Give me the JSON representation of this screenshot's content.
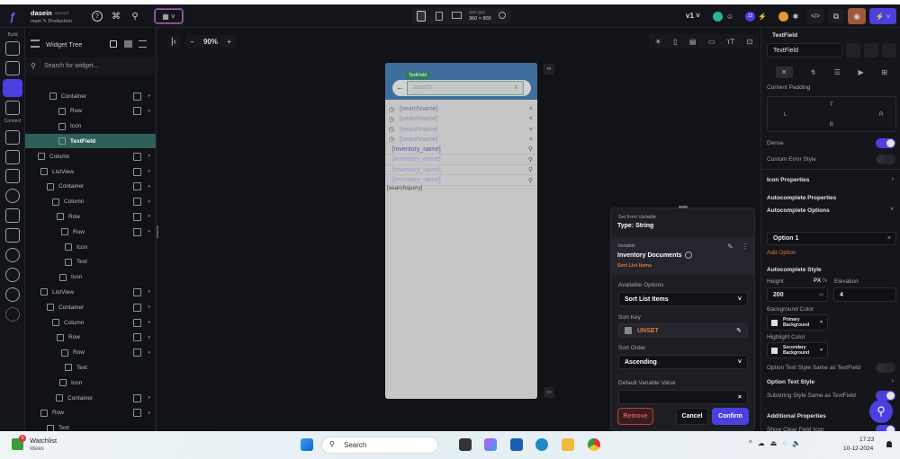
{
  "project": {
    "name": "dasein",
    "sync": "Synced",
    "branch": "main",
    "env": "Production"
  },
  "toolbar": {
    "size_label": "Size (px)",
    "size_value": "360 × 800",
    "version": "v1",
    "badge_count": "12",
    "zoom": "90%"
  },
  "rail": {
    "build_label": "Build",
    "connect_label": "Connect"
  },
  "tree": {
    "title": "Widget Tree",
    "search_placeholder": "Search for widget...",
    "rows": [
      {
        "label": "Container",
        "indent": 27
      },
      {
        "label": "Row",
        "indent": 37
      },
      {
        "label": "Icon",
        "indent": 37,
        "leaf": true
      },
      {
        "label": "TextField",
        "indent": 37,
        "leaf": true,
        "selected": true
      },
      {
        "label": "Column",
        "indent": 14
      },
      {
        "label": "ListView",
        "indent": 17
      },
      {
        "label": "Container",
        "indent": 24
      },
      {
        "label": "Column",
        "indent": 30
      },
      {
        "label": "Row",
        "indent": 35
      },
      {
        "label": "Row",
        "indent": 40
      },
      {
        "label": "Icon",
        "indent": 44,
        "leaf": true
      },
      {
        "label": "Text",
        "indent": 44,
        "leaf": true
      },
      {
        "label": "Icon",
        "indent": 38,
        "leaf": true
      },
      {
        "label": "ListView",
        "indent": 17
      },
      {
        "label": "Container",
        "indent": 24
      },
      {
        "label": "Column",
        "indent": 30
      },
      {
        "label": "Row",
        "indent": 35
      },
      {
        "label": "Row",
        "indent": 40
      },
      {
        "label": "Text",
        "indent": 44,
        "leaf": true
      },
      {
        "label": "Icon",
        "indent": 38,
        "leaf": true
      },
      {
        "label": "Container",
        "indent": 34
      },
      {
        "label": "Row",
        "indent": 17
      },
      {
        "label": "Text",
        "indent": 24,
        "leaf": true
      }
    ]
  },
  "phone": {
    "tag": "TextField",
    "placeholder": "search",
    "history": [
      "[searchname]",
      "[searchname]",
      "[searchname]",
      "[searchname]"
    ],
    "suggestions": [
      "[inventory_name]",
      "[inventory_name]",
      "[inventory_name]",
      "[inventory_name]"
    ],
    "query": "[searchquery]"
  },
  "dialog": {
    "header_label": "Set from Variable",
    "type": "Type: String",
    "variable_label": "Variable",
    "variable_name": "Inventory Documents",
    "variable_sub": "Sort List Items",
    "options_label": "Available Options",
    "options_value": "Sort List Items",
    "sort_key_label": "Sort Key",
    "sort_key_value": "UNSET",
    "sort_order_label": "Sort Order",
    "sort_order_value": "Ascending",
    "default_label": "Default Variable Value",
    "remove": "Remove",
    "cancel": "Cancel",
    "confirm": "Confirm"
  },
  "props": {
    "widget": "TextField",
    "name_value": "TextField",
    "content_padding": "Content Padding",
    "pad": {
      "t": "T",
      "l": "L",
      "r": "R",
      "b": "B"
    },
    "dense": "Dense",
    "custom_error": "Custom Error Style",
    "icon_props": "Icon Properties",
    "auto_props": "Autocomplete Properties",
    "auto_options": "Autocomplete Options",
    "option1": "Option 1",
    "add_option": "Add Option",
    "auto_style": "Autocomplete Style",
    "height_label": "Height",
    "px": "PX",
    "pct": "%",
    "height_value": "200",
    "inf": "∞",
    "elevation_label": "Elevation",
    "elevation_value": "4",
    "bg_label": "Background Color",
    "bg_value": "Primary Background",
    "hl_label": "Highlight Color",
    "hl_value": "Secondary Background",
    "opt_same": "Option Text Style Same as TextField",
    "opt_style": "Option Text Style",
    "substr_same": "Substring Style Same as TextField",
    "additional": "Additional Properties",
    "show_clear": "Show Clear Field Icon",
    "dense_on": true,
    "custom_error_on": false,
    "opt_same_on": false,
    "substr_same_on": true,
    "show_clear_on": true
  },
  "taskbar": {
    "widget_title": "Watchlist",
    "widget_sub": "Ideas",
    "widget_badge": "9",
    "search": "Search",
    "time": "17:23",
    "date": "10-12-2024"
  },
  "colors": {
    "accent": "#4b3fe0",
    "orange": "#e0773a",
    "teal": "#2e5f59",
    "phone_header": "#3d6e9c"
  }
}
